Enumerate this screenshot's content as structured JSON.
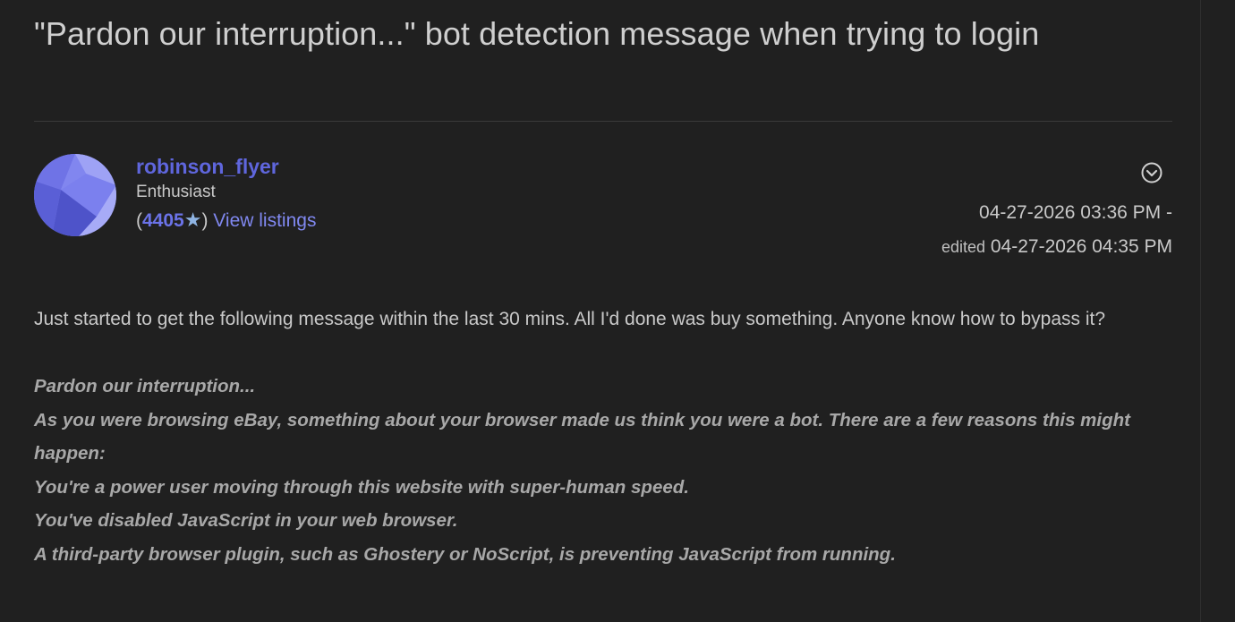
{
  "post": {
    "title": "\"Pardon our interruption...\" bot detection message when trying to login",
    "author": {
      "username": "robinson_flyer",
      "rank": "Enthusiast",
      "feedback_open": "(",
      "feedback_score": "4405",
      "feedback_star": "★",
      "feedback_close": ")",
      "view_listings": "View listings"
    },
    "posted_date": "04-27-2026 03:36 PM -",
    "edited_label": "edited",
    "edited_date": "04-27-2026 04:35 PM",
    "body_intro": "Just started to get the following message within the last 30 mins.  All I'd done was buy something.  Anyone know how to bypass it?",
    "quote_lines": [
      "Pardon our interruption...",
      "As you were browsing eBay, something about your browser made us think you were a bot. There are a few reasons this might happen:",
      "You're a power user moving through this website with super-human speed.",
      "You've disabled JavaScript in your web browser.",
      "A third-party browser plugin, such as Ghostery or NoScript, is preventing JavaScript from running."
    ]
  },
  "colors": {
    "background": "#202020",
    "username": "#5f66dd",
    "link": "#8088f0",
    "star": "#8fb4e3"
  },
  "icons": {
    "avatar": "avatar-geometric-purple",
    "options": "chevron-down-circle-icon"
  }
}
